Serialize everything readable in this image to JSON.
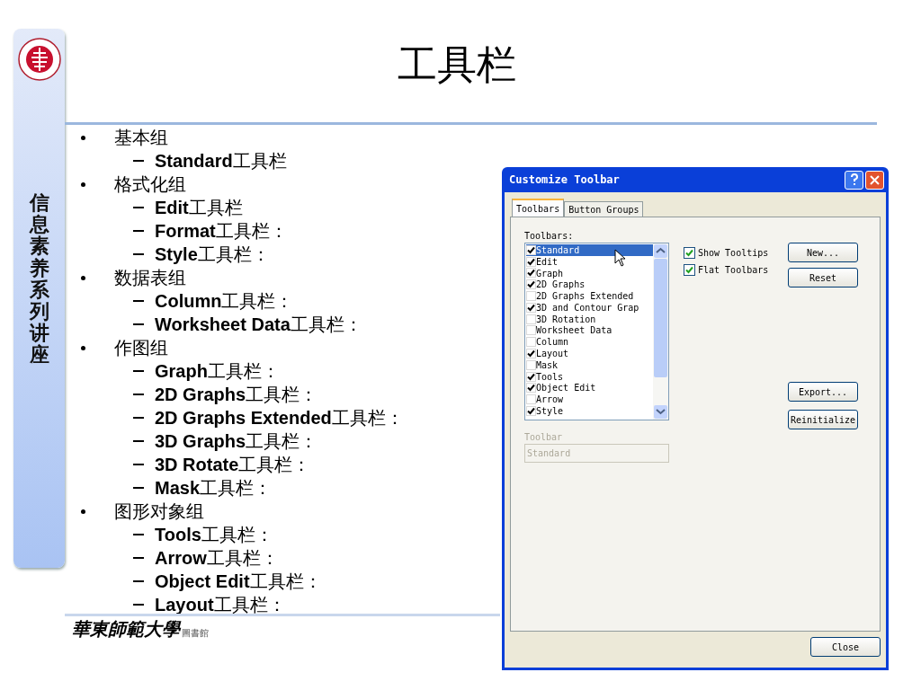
{
  "sidebar": {
    "title": "信息素养系列讲座"
  },
  "slide": {
    "title": "工具栏",
    "outline": [
      {
        "text": "基本组",
        "children": [
          {
            "text": "**Standard**工具栏"
          }
        ]
      },
      {
        "text": "格式化组",
        "children": [
          {
            "text": "**Edit**工具栏"
          },
          {
            "text": "**Format**工具栏："
          },
          {
            "text": "**Style**工具栏："
          }
        ]
      },
      {
        "text": "数据表组",
        "children": [
          {
            "text": "**Column**工具栏："
          },
          {
            "text": "**Worksheet Data**工具栏："
          }
        ]
      },
      {
        "text": "作图组",
        "children": [
          {
            "text": "**Graph**工具栏："
          },
          {
            "text": "**2D Graphs**工具栏："
          },
          {
            "text": "**2D Graphs Extended**工具栏："
          },
          {
            "text": "**3D Graphs**工具栏："
          },
          {
            "text": "**3D Rotate**工具栏："
          },
          {
            "text": "**Mask**工具栏："
          }
        ]
      },
      {
        "text": "图形对象组",
        "children": [
          {
            "text": "**Tools**工具栏："
          },
          {
            "text": "**Arrow**工具栏："
          },
          {
            "text": "**Object Edit**工具栏："
          },
          {
            "text": "**Layout**工具栏："
          }
        ]
      }
    ],
    "footer": {
      "name": "華東師範大學",
      "unit": "圖書館"
    }
  },
  "dialog": {
    "title": "Customize Toolbar",
    "tabs": [
      {
        "label": "Toolbars",
        "selected": true
      },
      {
        "label": "Button Groups",
        "selected": false
      }
    ],
    "list_label": "Toolbars:",
    "toolbars": [
      {
        "label": "Standard",
        "checked": true,
        "selected": true
      },
      {
        "label": "Edit",
        "checked": true,
        "selected": false
      },
      {
        "label": "Graph",
        "checked": true,
        "selected": false
      },
      {
        "label": "2D Graphs",
        "checked": true,
        "selected": false
      },
      {
        "label": "2D Graphs Extended",
        "checked": false,
        "selected": false
      },
      {
        "label": "3D and Contour Grap",
        "checked": true,
        "selected": false
      },
      {
        "label": "3D Rotation",
        "checked": false,
        "selected": false
      },
      {
        "label": "Worksheet Data",
        "checked": false,
        "selected": false
      },
      {
        "label": "Column",
        "checked": false,
        "selected": false
      },
      {
        "label": "Layout",
        "checked": true,
        "selected": false
      },
      {
        "label": "Mask",
        "checked": false,
        "selected": false
      },
      {
        "label": "Tools",
        "checked": true,
        "selected": false
      },
      {
        "label": "Object Edit",
        "checked": true,
        "selected": false
      },
      {
        "label": "Arrow",
        "checked": false,
        "selected": false
      },
      {
        "label": "Style",
        "checked": true,
        "selected": false
      }
    ],
    "options": [
      {
        "label": "Show Tooltips",
        "checked": true
      },
      {
        "label": "Flat Toolbars",
        "checked": true
      }
    ],
    "buttons_top": [
      "New...",
      "Reset"
    ],
    "buttons_bottom": [
      "Export...",
      "Reinitialize"
    ],
    "name_label": "Toolbar",
    "name_field": {
      "value": "Standard",
      "disabled": true
    },
    "close": "Close"
  }
}
